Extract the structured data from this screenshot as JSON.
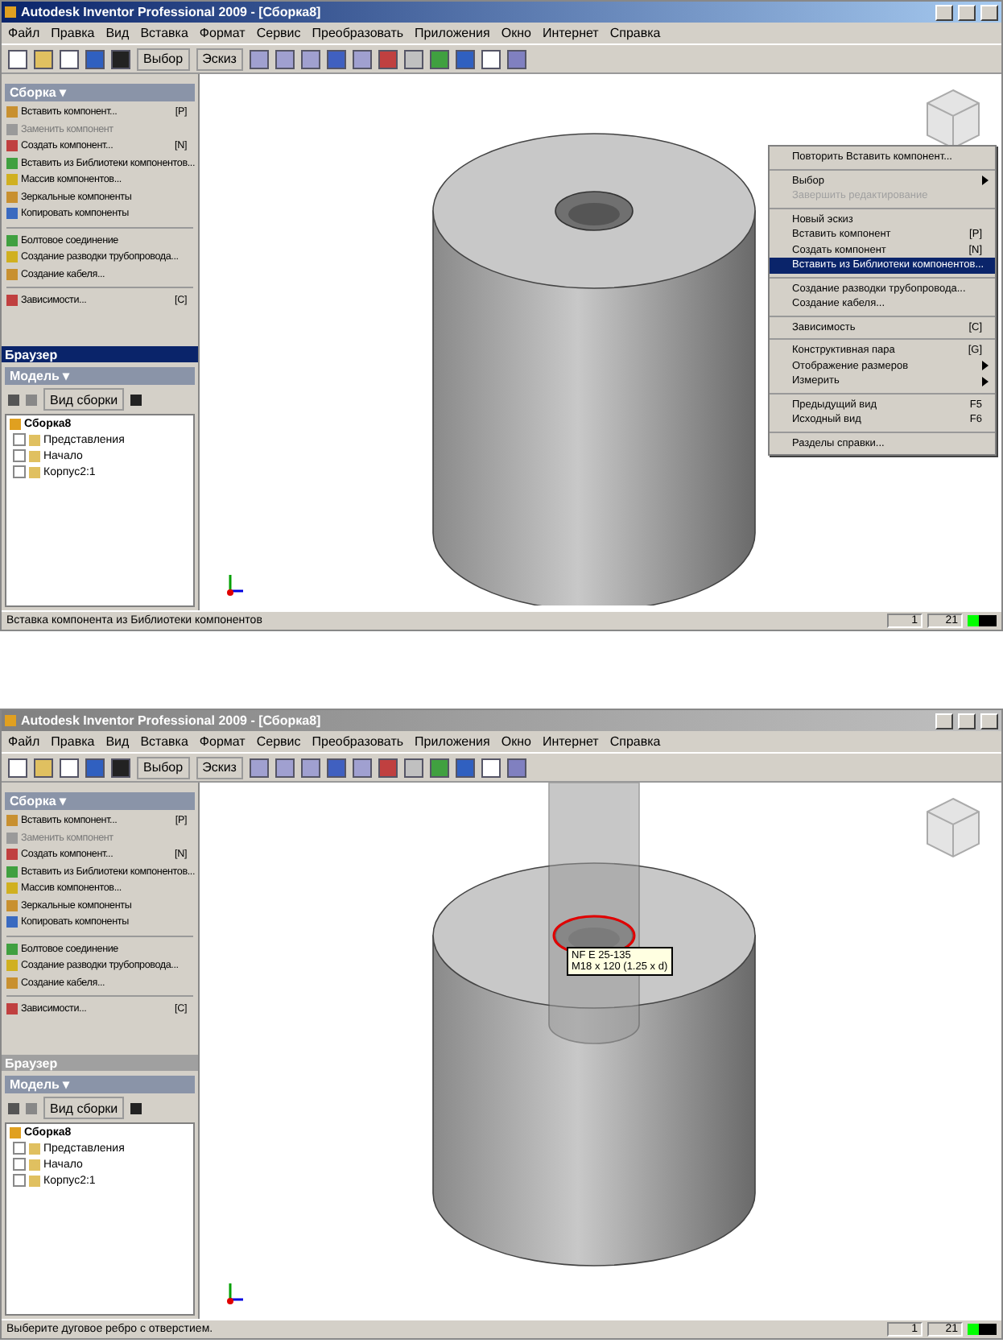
{
  "windows": [
    {
      "title": "Autodesk Inventor Professional 2009 - [Сборка8]",
      "active": true,
      "menu": [
        "Файл",
        "Правка",
        "Вид",
        "Вставка",
        "Формат",
        "Сервис",
        "Преобразовать",
        "Приложения",
        "Окно",
        "Интернет",
        "Справка"
      ],
      "toolbar": [
        "Выбор",
        "Эскиз"
      ],
      "panel": {
        "title": "Сборка ▾",
        "items": [
          {
            "kind": "item",
            "label": "Вставить компонент...",
            "shortcut": "[P]",
            "disabled": false
          },
          {
            "kind": "item",
            "label": "Заменить компонент",
            "disabled": true
          },
          {
            "kind": "item",
            "label": "Создать компонент...",
            "shortcut": "[N]",
            "disabled": false
          },
          {
            "kind": "item",
            "label": "Вставить из Библиотеки компонентов...",
            "disabled": false
          },
          {
            "kind": "item",
            "label": "Массив компонентов...",
            "disabled": false
          },
          {
            "kind": "item",
            "label": "Зеркальные компоненты",
            "disabled": false
          },
          {
            "kind": "item",
            "label": "Копировать компоненты",
            "disabled": false
          },
          {
            "kind": "separator"
          },
          {
            "kind": "item",
            "label": "Болтовое соединение",
            "disabled": false
          },
          {
            "kind": "item",
            "label": "Создание разводки трубопровода...",
            "disabled": false
          },
          {
            "kind": "item",
            "label": "Создание кабеля...",
            "disabled": false
          },
          {
            "kind": "separator"
          },
          {
            "kind": "item",
            "label": "Зависимости...",
            "shortcut": "[C]",
            "disabled": false
          }
        ]
      },
      "browser": {
        "title": "Браузер",
        "active": true,
        "header": "Модель ▾",
        "view": "Вид сборки",
        "tree": {
          "label": "Сборка8",
          "children": [
            {
              "label": "Представления"
            },
            {
              "label": "Начало"
            },
            {
              "label": "Корпус2:1"
            }
          ]
        }
      },
      "viewport": {
        "rod": false,
        "context_menu": [
          {
            "kind": "item",
            "label": "Повторить Вставить компонент...",
            "selected": false,
            "disabled": false
          },
          {
            "kind": "separator"
          },
          {
            "kind": "submenu",
            "label": "Выбор",
            "selected": false,
            "disabled": false
          },
          {
            "kind": "item",
            "label": "Завершить редактирование",
            "selected": false,
            "disabled": true
          },
          {
            "kind": "separator"
          },
          {
            "kind": "item",
            "label": "Новый эскиз",
            "selected": false,
            "disabled": false
          },
          {
            "kind": "item",
            "label": "Вставить компонент",
            "shortcut": "[P]",
            "selected": false,
            "disabled": false
          },
          {
            "kind": "item",
            "label": "Создать компонент",
            "shortcut": "[N]",
            "selected": false,
            "disabled": false
          },
          {
            "kind": "item",
            "label": "Вставить из Библиотеки компонентов...",
            "selected": true,
            "disabled": false
          },
          {
            "kind": "separator"
          },
          {
            "kind": "item",
            "label": "Создание разводки трубопровода...",
            "selected": false,
            "disabled": false
          },
          {
            "kind": "item",
            "label": "Создание кабеля...",
            "selected": false,
            "disabled": false
          },
          {
            "kind": "separator"
          },
          {
            "kind": "item",
            "label": "Зависимость",
            "shortcut": "[C]",
            "selected": false,
            "disabled": false
          },
          {
            "kind": "separator"
          },
          {
            "kind": "item",
            "label": "Конструктивная пара",
            "shortcut": "[G]",
            "selected": false,
            "disabled": false
          },
          {
            "kind": "submenu",
            "label": "Отображение размеров",
            "selected": false,
            "disabled": false
          },
          {
            "kind": "submenu",
            "label": "Измерить",
            "selected": false,
            "disabled": false
          },
          {
            "kind": "separator"
          },
          {
            "kind": "item",
            "label": "Предыдущий вид",
            "shortcut": "F5",
            "selected": false,
            "disabled": false
          },
          {
            "kind": "item",
            "label": "Исходный вид",
            "shortcut": "F6",
            "selected": false,
            "disabled": false
          },
          {
            "kind": "separator"
          },
          {
            "kind": "item",
            "label": "Разделы справки...",
            "selected": false,
            "disabled": false
          }
        ]
      },
      "status": {
        "text": "Вставка компонента из Библиотеки компонентов",
        "fields": [
          "1",
          "21"
        ]
      }
    },
    {
      "title": "Autodesk Inventor Professional 2009 - [Сборка8]",
      "active": false,
      "menu": [
        "Файл",
        "Правка",
        "Вид",
        "Вставка",
        "Формат",
        "Сервис",
        "Преобразовать",
        "Приложения",
        "Окно",
        "Интернет",
        "Справка"
      ],
      "toolbar": [
        "Выбор",
        "Эскиз"
      ],
      "panel": {
        "title": "Сборка ▾",
        "items": [
          {
            "kind": "item",
            "label": "Вставить компонент...",
            "shortcut": "[P]",
            "disabled": false
          },
          {
            "kind": "item",
            "label": "Заменить компонент",
            "disabled": true
          },
          {
            "kind": "item",
            "label": "Создать компонент...",
            "shortcut": "[N]",
            "disabled": false
          },
          {
            "kind": "item",
            "label": "Вставить из Библиотеки компонентов...",
            "disabled": false
          },
          {
            "kind": "item",
            "label": "Массив компонентов...",
            "disabled": false
          },
          {
            "kind": "item",
            "label": "Зеркальные компоненты",
            "disabled": false
          },
          {
            "kind": "item",
            "label": "Копировать компоненты",
            "disabled": false
          },
          {
            "kind": "separator"
          },
          {
            "kind": "item",
            "label": "Болтовое соединение",
            "disabled": false
          },
          {
            "kind": "item",
            "label": "Создание разводки трубопровода...",
            "disabled": false
          },
          {
            "kind": "item",
            "label": "Создание кабеля...",
            "disabled": false
          },
          {
            "kind": "separator"
          },
          {
            "kind": "item",
            "label": "Зависимости...",
            "shortcut": "[C]",
            "disabled": false
          }
        ]
      },
      "browser": {
        "title": "Браузер",
        "active": false,
        "header": "Модель ▾",
        "view": "Вид сборки",
        "tree": {
          "label": "Сборка8",
          "children": [
            {
              "label": "Представления"
            },
            {
              "label": "Начало"
            },
            {
              "label": "Корпус2:1"
            }
          ]
        }
      },
      "viewport": {
        "rod": true,
        "tooltip": [
          "NF E 25-135",
          "M18 x 120 (1.25 x d)"
        ]
      },
      "status": {
        "text": "Выберите дуговое ребро с отверстием.",
        "fields": [
          "1",
          "21"
        ]
      }
    }
  ]
}
